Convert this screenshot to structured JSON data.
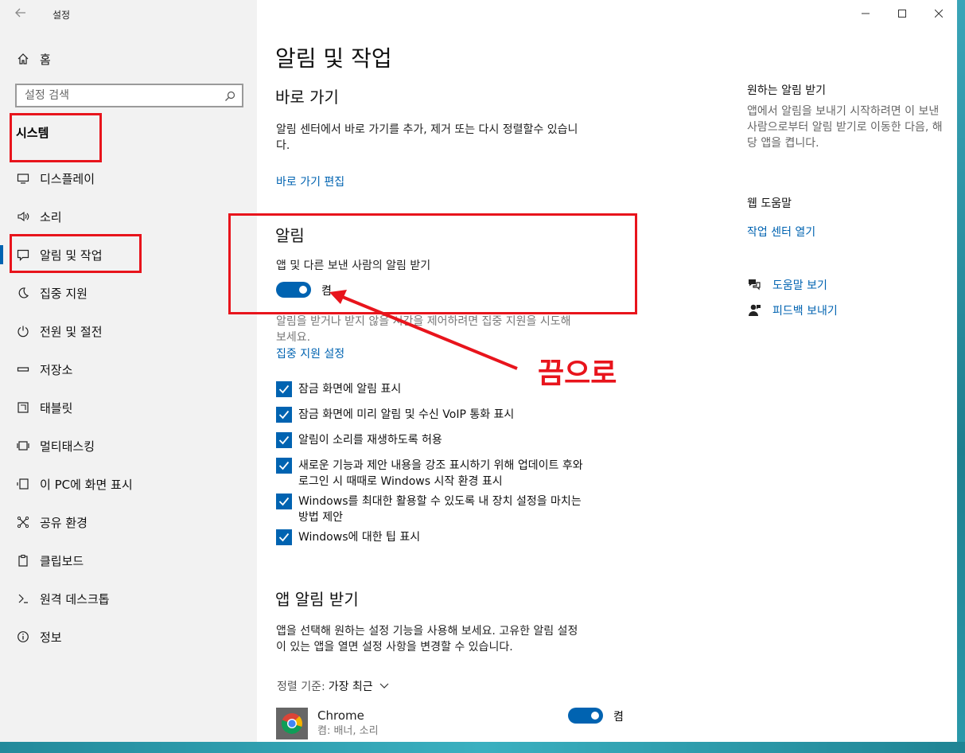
{
  "window": {
    "app_title": "설정"
  },
  "sidebar": {
    "home_label": "홈",
    "search_placeholder": "설정 검색",
    "section_label": "시스템",
    "items": [
      {
        "label": "디스플레이",
        "icon": "monitor-icon"
      },
      {
        "label": "소리",
        "icon": "speaker-icon"
      },
      {
        "label": "알림 및 작업",
        "icon": "notification-icon",
        "selected": true
      },
      {
        "label": "집중 지원",
        "icon": "moon-icon"
      },
      {
        "label": "전원 및 절전",
        "icon": "power-icon"
      },
      {
        "label": "저장소",
        "icon": "storage-icon"
      },
      {
        "label": "태블릿",
        "icon": "tablet-icon"
      },
      {
        "label": "멀티태스킹",
        "icon": "multitasking-icon"
      },
      {
        "label": "이 PC에 화면 표시",
        "icon": "project-icon"
      },
      {
        "label": "공유 환경",
        "icon": "share-icon"
      },
      {
        "label": "클립보드",
        "icon": "clipboard-icon"
      },
      {
        "label": "원격 데스크톱",
        "icon": "remote-icon"
      },
      {
        "label": "정보",
        "icon": "info-icon"
      }
    ]
  },
  "main": {
    "page_title": "알림 및 작업",
    "shortcuts": {
      "heading": "바로 가기",
      "description_line1": "알림 센터에서 바로 가기를 추가, 제거 또는 다시 정렬할수 있습니",
      "description_line2": "다.",
      "edit_link": "바로 가기 편집"
    },
    "notifications": {
      "heading": "알림",
      "toggle_label": "앱 및 다른 보낸 사람의 알림 받기",
      "toggle_state": "켬",
      "focus_hint_line1": "알림을 받거나 받지 않을 시간을 제어하려면 집중 지원을 시도해",
      "focus_hint_line2": "보세요.",
      "focus_link": "집중 지원 설정"
    },
    "checkboxes": [
      {
        "line1": "잠금 화면에 알림 표시",
        "line2": ""
      },
      {
        "line1": "잠금 화면에 미리 알림 및 수신 VoIP 통화 표시",
        "line2": ""
      },
      {
        "line1": "알림이 소리를 재생하도록 허용",
        "line2": ""
      },
      {
        "line1": "새로운 기능과 제안 내용을 강조 표시하기 위해 업데이트 후와",
        "line2": "로그인 시 때때로 Windows 시작 환경 표시"
      },
      {
        "line1": "Windows를 최대한 활용할 수 있도록 내 장치 설정을 마치는",
        "line2": "방법 제안"
      },
      {
        "line1": "Windows에 대한 팁 표시",
        "line2": ""
      }
    ],
    "app_notifications": {
      "heading": "앱 알림 받기",
      "description_line1": "앱을 선택해 원하는 설정 기능을 사용해 보세요. 고유한 알림 설정",
      "description_line2": "이 있는 앱을 열면 설정 사항을 변경할 수 있습니다.",
      "sort_key": "정렬 기준:",
      "sort_value": "가장 최근",
      "app_name": "Chrome",
      "app_detail": "켬: 배너, 소리",
      "app_toggle_state": "켬"
    }
  },
  "right": {
    "get_notified_title": "원하는 알림 받기",
    "get_notified_text": "앱에서 알림을 보내기 시작하려면 이 보낸 사람으로부터 알림 받기로 이동한 다음, 해당 앱을 켭니다.",
    "web_help_title": "웹 도움말",
    "action_center_link": "작업 센터 열기",
    "help_link": "도움말 보기",
    "feedback_link": "피드백 보내기"
  },
  "annotation": {
    "text": "끔으로",
    "color": "#e8141c"
  },
  "colors": {
    "accent": "#0063b1",
    "sidebar_bg": "#f2f2f2"
  }
}
